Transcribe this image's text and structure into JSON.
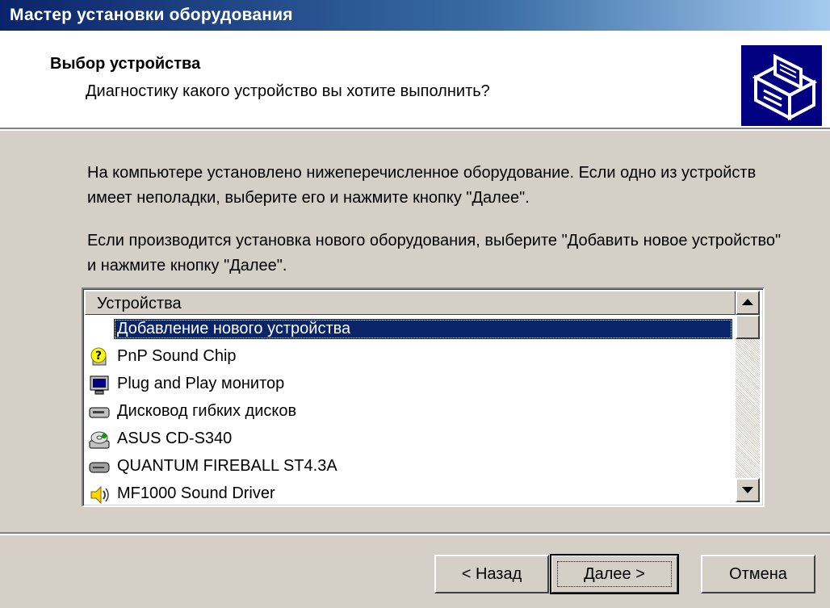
{
  "window": {
    "title": "Мастер установки оборудования"
  },
  "header": {
    "title": "Выбор устройства",
    "subtitle": "Диагностику какого устройство вы хотите выполнить?",
    "icon": "hardware-wizard-icon"
  },
  "body": {
    "paragraph1": "На компьютере установлено нижеперечисленное оборудование. Если одно из устройств имеет неполадки, выберите его и нажмите кнопку \"Далее\".",
    "paragraph2": "Если производится установка нового оборудования, выберите \"Добавить новое устройство\" и нажмите кнопку \"Далее\"."
  },
  "device_list": {
    "column_header": "Устройства",
    "items": [
      {
        "label": "Добавление нового устройства",
        "icon": "none",
        "selected": true
      },
      {
        "label": "PnP Sound Chip",
        "icon": "unknown-device-icon",
        "selected": false
      },
      {
        "label": "Plug and Play монитор",
        "icon": "monitor-icon",
        "selected": false
      },
      {
        "label": "Дисковод гибких дисков",
        "icon": "floppy-drive-icon",
        "selected": false
      },
      {
        "label": "ASUS CD-S340",
        "icon": "cd-drive-icon",
        "selected": false
      },
      {
        "label": "QUANTUM FIREBALL ST4.3A",
        "icon": "hard-disk-icon",
        "selected": false
      },
      {
        "label": "MF1000 Sound Driver",
        "icon": "speaker-icon",
        "selected": false
      }
    ]
  },
  "buttons": {
    "back": "< Назад",
    "next": "Далее >",
    "cancel": "Отмена"
  },
  "colors": {
    "title_bar": "#0a246a",
    "dialog_face": "#d4d0c8",
    "selection": "#0a246a"
  }
}
